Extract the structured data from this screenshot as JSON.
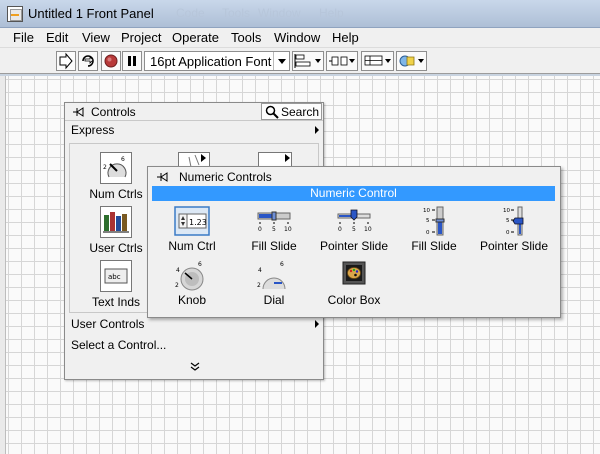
{
  "window": {
    "title": "Untitled 1 Front Panel",
    "background_menu_ghost": [
      "Code",
      "Tools",
      "Window",
      "Help"
    ]
  },
  "menubar": {
    "items": [
      "File",
      "Edit",
      "View",
      "Project",
      "Operate",
      "Tools",
      "Window",
      "Help"
    ]
  },
  "toolbar": {
    "font": "16pt Application Font",
    "buttons": [
      "run-arrow-icon",
      "run-continuously-icon",
      "abort-icon",
      "pause-icon",
      "align-icon",
      "distribute-icon",
      "resize-icon",
      "reorder-icon"
    ]
  },
  "controls_palette": {
    "title": "Controls",
    "search": "Search",
    "express": "Express",
    "categories": [
      "Num Ctrls",
      "User Ctrls",
      "Text Inds"
    ],
    "user_controls": "User Controls",
    "select_control": "Select a Control...",
    "expand": "»"
  },
  "numeric_palette": {
    "title": "Numeric Controls",
    "selected": "Numeric Control",
    "numeric_value": "1.23",
    "items": [
      "Num Ctrl",
      "Fill Slide",
      "Pointer Slide",
      "Fill Slide",
      "Pointer Slide",
      "Knob",
      "Dial",
      "Color Box"
    ],
    "slide_ticks": [
      "0",
      "5",
      "10"
    ]
  },
  "colors": {
    "selection": "#3399ff",
    "grid": "#d6d6d6",
    "slide_fill": "#2a56c6"
  }
}
